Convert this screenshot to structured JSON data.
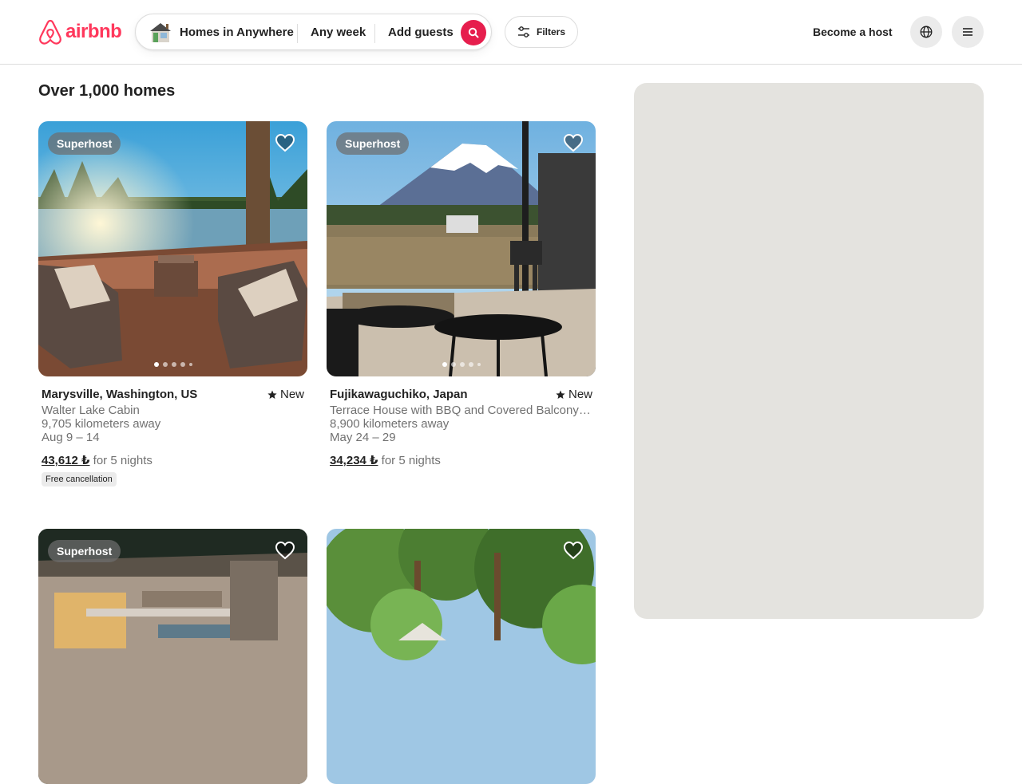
{
  "brand": {
    "name": "airbnb",
    "color": "#ff385c"
  },
  "search": {
    "where": "Homes in Anywhere",
    "when": "Any week",
    "who": "Add guests",
    "button_color": "#e61e4d"
  },
  "filters": {
    "label": "Filters"
  },
  "header_right": {
    "host_link": "Become a host"
  },
  "results": {
    "title": "Over 1,000 homes"
  },
  "listings": [
    {
      "badge": "Superhost",
      "location": "Marysville, Washington, US",
      "rating": "New",
      "name": "Walter Lake Cabin",
      "distance": "9,705 kilometers away",
      "dates": "Aug 9 – 14",
      "price": "43,612 ₺",
      "price_suffix": "for 5 nights",
      "tag": "Free cancellation"
    },
    {
      "badge": "Superhost",
      "location": "Fujikawaguchiko, Japan",
      "rating": "New",
      "name": "Terrace House with BBQ and Covered Balcony and Mt. Fuji View",
      "distance": "8,900 kilometers away",
      "dates": "May 24 – 29",
      "price": "34,234 ₺",
      "price_suffix": "for 5 nights",
      "tag": ""
    },
    {
      "badge": "Superhost"
    },
    {
      "badge": ""
    }
  ]
}
